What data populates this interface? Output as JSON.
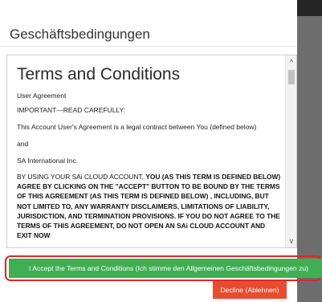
{
  "dialog": {
    "title": "Geschäftsbedingungen"
  },
  "terms": {
    "heading": "Terms and Conditions",
    "lines": [
      "User Agreement",
      "IMPORTANT—READ CAREFULLY:",
      "This Account User's Agreement is a legal contract between You (defined below)",
      "and",
      "SA International Inc."
    ],
    "para_intro": "BY USING YOUR SAi CLOUD ACCOUNT, ",
    "para_bold": "YOU (AS THIS TERM IS DEFINED BELOW) AGREE BY CLICKING ON THE \"ACCEPT\" BUTTON TO BE BOUND BY THE TERMS OF THIS AGREEMENT (AS THIS TERM IS DEFINED BELOW) , INCLUDING, BUT NOT LIMITED TO, ANY WARRANTY DISCLAIMERS, LIMITATIONS OF LIABILITY, JURISDICTION, AND TERMINATION PROVISIONS. IF YOU DO NOT AGREE TO THE TERMS OF THIS AGREEMENT, DO NOT OPEN AN SAi CLOUD ACCOUNT AND EXIT NOW"
  },
  "scrollbar": {
    "up_glyph": "^",
    "down_glyph": "v"
  },
  "buttons": {
    "accept": "I Accept the Terms and Conditions (Ich stimme den Allgemeinen Geschäftsbedingungen zu)",
    "decline": "Decline (Ablehnen)"
  },
  "colors": {
    "accept": "#3fae55",
    "decline": "#e94b2e",
    "highlight": "#e0252b"
  }
}
